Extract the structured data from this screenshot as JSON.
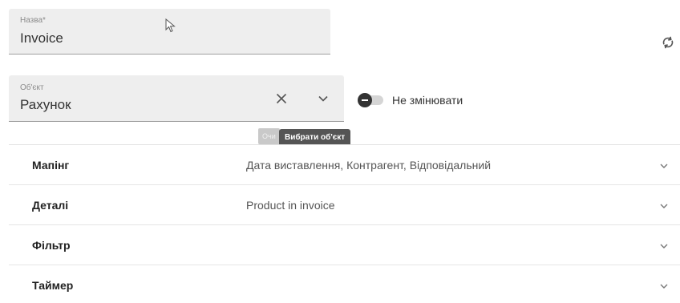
{
  "form": {
    "name_label": "Назва*",
    "name_value": "Invoice",
    "object_label": "Об'єкт",
    "object_value": "Рахунок",
    "toggle_label": "Не змінювати",
    "toggle_on": false
  },
  "tooltips": {
    "clear_partial": "Очи",
    "select_object": "Вибрати об'єкт"
  },
  "icons": {
    "cursor": "mouse-pointer-icon",
    "refresh": "refresh-icon",
    "clear": "close-icon",
    "dropdown": "chevron-down-icon"
  },
  "sections": [
    {
      "title": "Мапінг",
      "summary": "Дата виставлення, Контрагент, Відповідальний"
    },
    {
      "title": "Деталі",
      "summary": "Product in invoice"
    },
    {
      "title": "Фільтр",
      "summary": ""
    },
    {
      "title": "Таймер",
      "summary": ""
    }
  ]
}
